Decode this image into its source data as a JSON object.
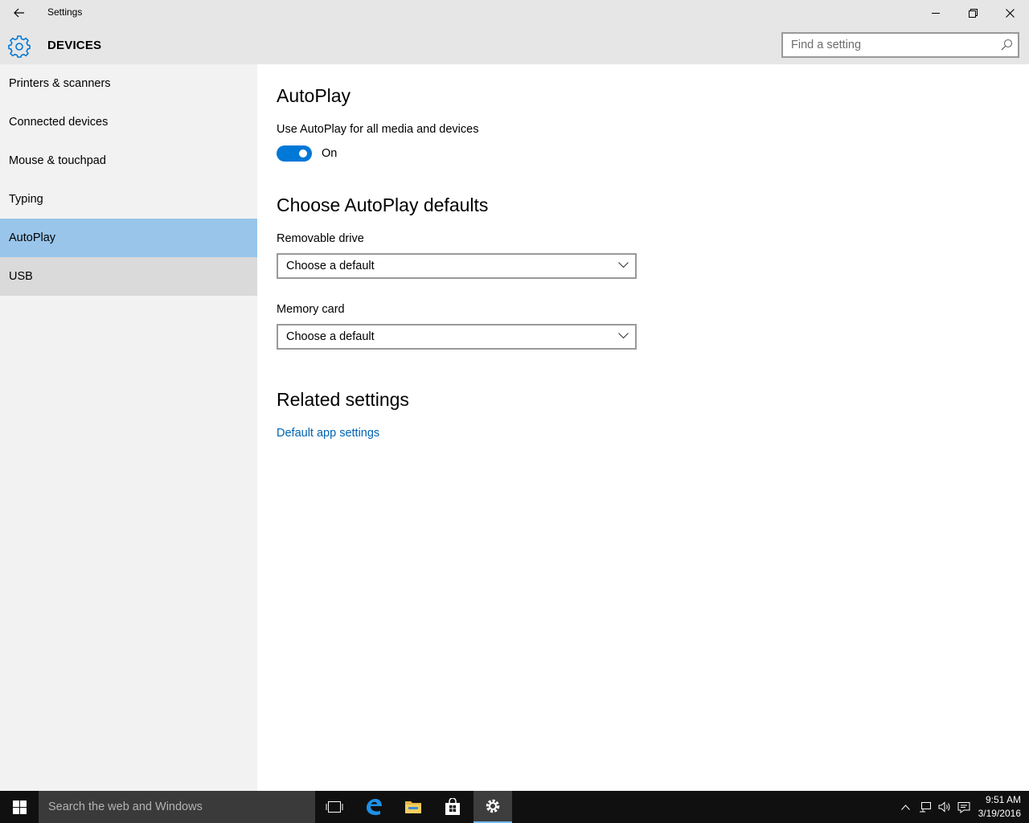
{
  "window": {
    "title": "Settings"
  },
  "header": {
    "category": "DEVICES",
    "search_placeholder": "Find a setting"
  },
  "sidebar": {
    "items": [
      {
        "label": "Printers & scanners"
      },
      {
        "label": "Connected devices"
      },
      {
        "label": "Mouse & touchpad"
      },
      {
        "label": "Typing"
      },
      {
        "label": "AutoPlay"
      },
      {
        "label": "USB"
      }
    ]
  },
  "main": {
    "title": "AutoPlay",
    "toggle_label": "Use AutoPlay for all media and devices",
    "toggle_state": "On",
    "defaults_title": "Choose AutoPlay defaults",
    "removable_label": "Removable drive",
    "removable_value": "Choose a default",
    "memory_label": "Memory card",
    "memory_value": "Choose a default",
    "related_title": "Related settings",
    "related_link": "Default app settings"
  },
  "taskbar": {
    "search_placeholder": "Search the web and Windows",
    "time": "9:51 AM",
    "date": "3/19/2016"
  },
  "colors": {
    "accent": "#0078d7",
    "selected_nav": "#99c5eb",
    "link": "#0063b1"
  }
}
